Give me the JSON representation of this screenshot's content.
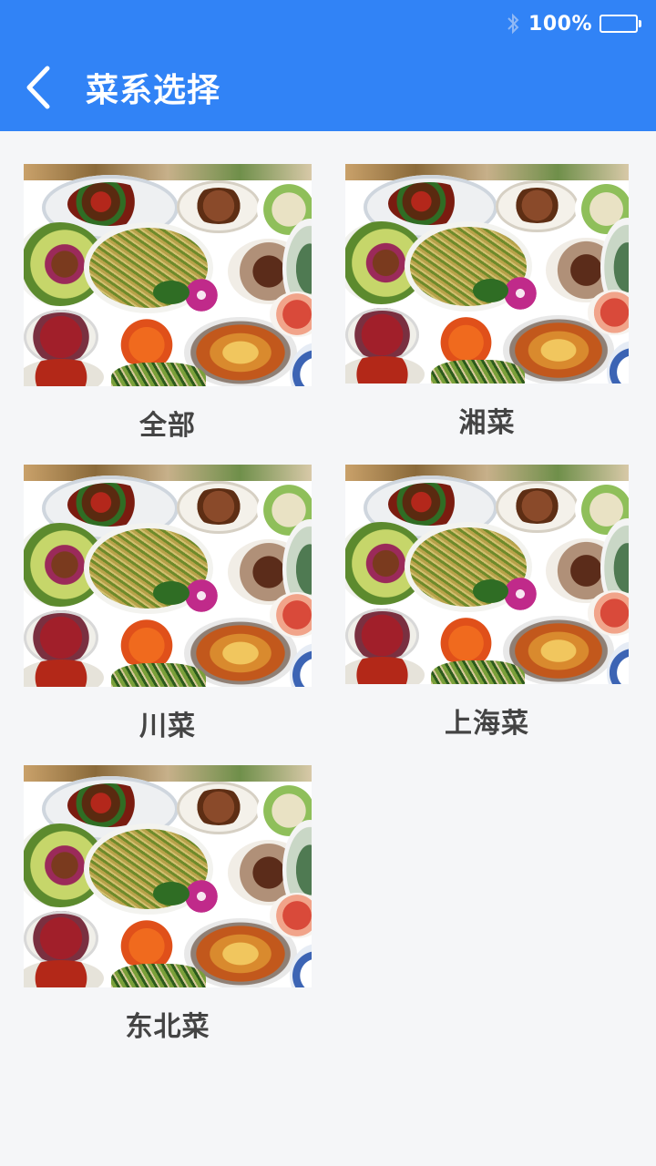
{
  "status_bar": {
    "battery_percent": "100%",
    "bluetooth_icon": "bluetooth-icon",
    "battery_icon": "battery-icon",
    "battery_level": 1.0
  },
  "header": {
    "title": "菜系选择",
    "back_icon": "chevron-left-icon"
  },
  "colors": {
    "header_bg": "#3183f6",
    "page_bg": "#f5f6f8",
    "label_text": "#444444"
  },
  "cuisines": [
    {
      "label": "全部"
    },
    {
      "label": "湘菜"
    },
    {
      "label": "川菜"
    },
    {
      "label": "上海菜"
    },
    {
      "label": "东北菜"
    }
  ]
}
